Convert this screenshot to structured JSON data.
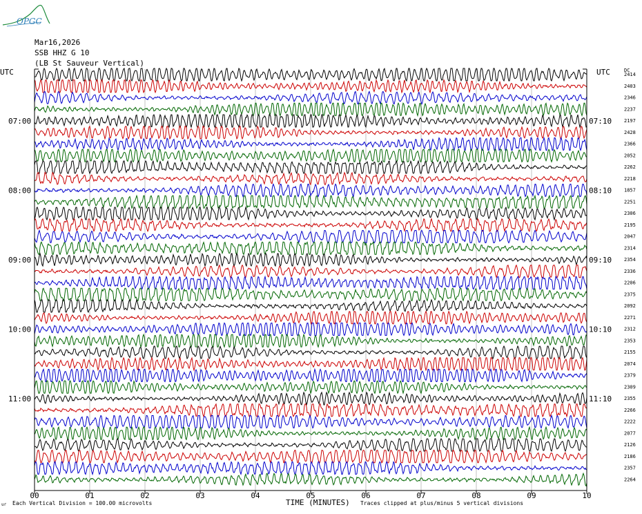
{
  "header": {
    "logo_text": "OPGC",
    "date": "Mar16,2026",
    "station": "SSB HHZ G 10",
    "location": "(LB  St Sauveur Vertical)"
  },
  "axes": {
    "left_title": "UTC",
    "right_title": "UTC",
    "scale_title": "DC"
  },
  "footer": {
    "tiny_mark": "ur",
    "left_text": "Each Vertical Division =  100.00 microvolts",
    "xaxis_title": "TIME (MINUTES)",
    "right_text": "Traces clipped at plus/minus 5 vertical divisions"
  },
  "chart_data": {
    "type": "line",
    "title": "SSB HHZ G 10 (LB  St Sauveur Vertical)",
    "xlabel": "TIME (MINUTES)",
    "ylabel": "",
    "xlim": [
      0,
      10
    ],
    "x_ticks": [
      "00",
      "01",
      "02",
      "03",
      "04",
      "05",
      "06",
      "07",
      "08",
      "09",
      "10"
    ],
    "trace_colors": [
      "#000000",
      "#cc0000",
      "#0000cc",
      "#006600"
    ],
    "left_time_labels": [
      {
        "row": 4,
        "label": "07:00"
      },
      {
        "row": 10,
        "label": "08:00"
      },
      {
        "row": 16,
        "label": "09:00"
      },
      {
        "row": 22,
        "label": "10:00"
      },
      {
        "row": 28,
        "label": "11:00"
      }
    ],
    "right_time_labels": [
      {
        "row": 4,
        "label": "07:10"
      },
      {
        "row": 10,
        "label": "08:10"
      },
      {
        "row": 16,
        "label": "09:10"
      },
      {
        "row": 22,
        "label": "10:10"
      },
      {
        "row": 28,
        "label": "11:10"
      }
    ],
    "dc_offsets": [
      2414,
      2403,
      2346,
      2237,
      2197,
      2428,
      2366,
      2052,
      2262,
      2218,
      1857,
      2251,
      2306,
      2195,
      2047,
      2314,
      2354,
      2336,
      2206,
      2375,
      2092,
      2271,
      2312,
      2353,
      2155,
      2074,
      2379,
      2309,
      2355,
      2266,
      2222,
      2077,
      2126,
      2186,
      2357,
      2264
    ],
    "trace_count": 36,
    "clip_divisions": 5,
    "vertical_division_microvolts": 100.0
  }
}
